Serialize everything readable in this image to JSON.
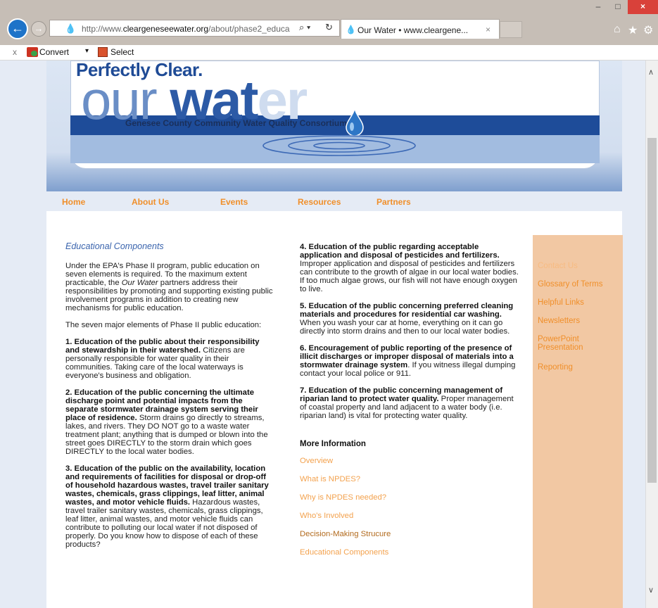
{
  "browser": {
    "url_prefix": "http://www.",
    "url_domain": "cleargeneseewater.org",
    "url_path": "/about/phase2_educa",
    "tab_title": "Our Water • www.cleargene...",
    "window_min": "–",
    "window_max": "□",
    "window_close": "×",
    "back_glyph": "←",
    "forward_glyph": "→",
    "search_glyph": "⌕ ▾",
    "refresh_glyph": "↻",
    "tab_close": "×",
    "icons": [
      "home-icon",
      "star-icon",
      "gear-icon"
    ]
  },
  "command_bar": {
    "close": "x",
    "convert": "Convert",
    "caret": "▾",
    "select": "Select"
  },
  "header": {
    "tagline": "Perfectly Clear.",
    "word_a": "our ",
    "word_b": "wat",
    "word_c": "er",
    "subtitle": "Genesee County Community Water Quality Consortium"
  },
  "nav": [
    "Home",
    "About Us",
    "Events",
    "Resources",
    "Partners"
  ],
  "main": {
    "section_title": "Educational Components",
    "intro_a": "Under the EPA's Phase II program, public education on seven elements is required.  To the maximum extent practicable, the ",
    "intro_em": "Our Water",
    "intro_b": " partners address their responsibilities by promoting and supporting existing public involvement programs in addition to creating new mechanisms for public education.",
    "lead": "The seven major elements of Phase II public education:",
    "elements": [
      {
        "title": "1. Education of the public about their responsibility and stewardship in their watershed.",
        "body": " Citizens are personally responsible for water quality in their communities.  Taking care of the local waterways is everyone's business and obligation."
      },
      {
        "title": "2. Education of the public concerning the ultimate discharge point and potential impacts from the separate stormwater drainage system serving their place of residence.",
        "body": " Storm drains go directly to streams, lakes, and rivers.  They DO NOT go to a waste water treatment plant; anything that is dumped or blown into the street goes DIRECTLY to the storm drain which goes DIRECTLY to the local water bodies."
      },
      {
        "title": "3. Education of the public on the availability, location and requirements of facilities for disposal or drop-off of household hazardous wastes, travel trailer sanitary wastes, chemicals, grass clippings, leaf litter, animal wastes, and motor vehicle fluids.",
        "body": " Hazardous wastes, travel trailer sanitary wastes, chemicals, grass clippings, leaf litter, animal wastes, and motor vehicle fluids can contribute to polluting our local water if not disposed of properly.  Do you know how to dispose of each of these products?"
      },
      {
        "title": "4. Education of the public regarding acceptable application and disposal of pesticides and fertilizers.",
        "body": " Improper application and disposal of pesticides and fertilizers can contribute to the growth of algae in our local water bodies.  If too much algae grows, our fish will not have enough oxygen to live."
      },
      {
        "title": "5. Education of the public concerning preferred cleaning materials and procedures for residential car washing.",
        "body": " When you wash your car at home, everything on it can go directly into storm drains and then to our local water bodies."
      },
      {
        "title": "6. Encouragement of public reporting of the presence of illicit discharges or improper disposal of materials into a stormwater drainage system",
        "body": ". If you witness illegal dumping contact your local police or 911."
      },
      {
        "title": "7. Education of the public concerning management of riparian land to protect water quality.",
        "body": " Proper management of coastal property and land adjacent to a water body (i.e. riparian land) is vital for protecting water quality."
      }
    ],
    "more_title": "More Information",
    "more_links": [
      {
        "label": "Overview",
        "current": false
      },
      {
        "label": "What is NPDES?",
        "current": false
      },
      {
        "label": "Why is NPDES needed?",
        "current": false
      },
      {
        "label": "Who's Involved",
        "current": false
      },
      {
        "label": "Decision-Making Strucure",
        "current": true
      },
      {
        "label": "Educational Components",
        "current": false
      }
    ]
  },
  "sidebar": [
    "Contact Us",
    "Glossary of Terms",
    "Helpful Links",
    "Newsletters",
    "PowerPoint Presentation",
    "Reporting"
  ],
  "colors": {
    "nav_orange": "#f08f2a",
    "banner_blue": "#1e4c99",
    "sidebar_bg": "#f2c8a3",
    "title_blue": "#3a64ad"
  }
}
